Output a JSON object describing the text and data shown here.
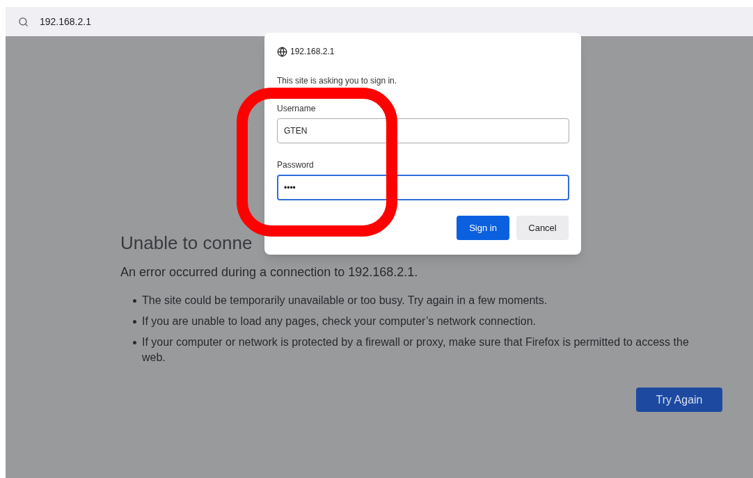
{
  "address_bar": {
    "url": "192.168.2.1"
  },
  "error_page": {
    "title": "Unable to conne",
    "message": "An error occurred during a connection to 192.168.2.1.",
    "bullets": [
      "The site could be temporarily unavailable or too busy. Try again in a few moments.",
      "If you are unable to load any pages, check your computer’s network connection.",
      "If your computer or network is protected by a firewall or proxy, make sure that Firefox is permitted to access the web."
    ],
    "button": "Try Again"
  },
  "dialog": {
    "host": "192.168.2.1",
    "prompt": "This site is asking you to sign in.",
    "fields": [
      {
        "label": "Username",
        "value": "GTEN",
        "focused": false
      },
      {
        "label": "Password",
        "value": "••••",
        "focused": true
      }
    ],
    "buttons": [
      {
        "label": "Sign in",
        "kind": "primary"
      },
      {
        "label": "Cancel",
        "kind": "secondary"
      }
    ]
  },
  "annotation": {
    "kind": "highlight-frame"
  }
}
